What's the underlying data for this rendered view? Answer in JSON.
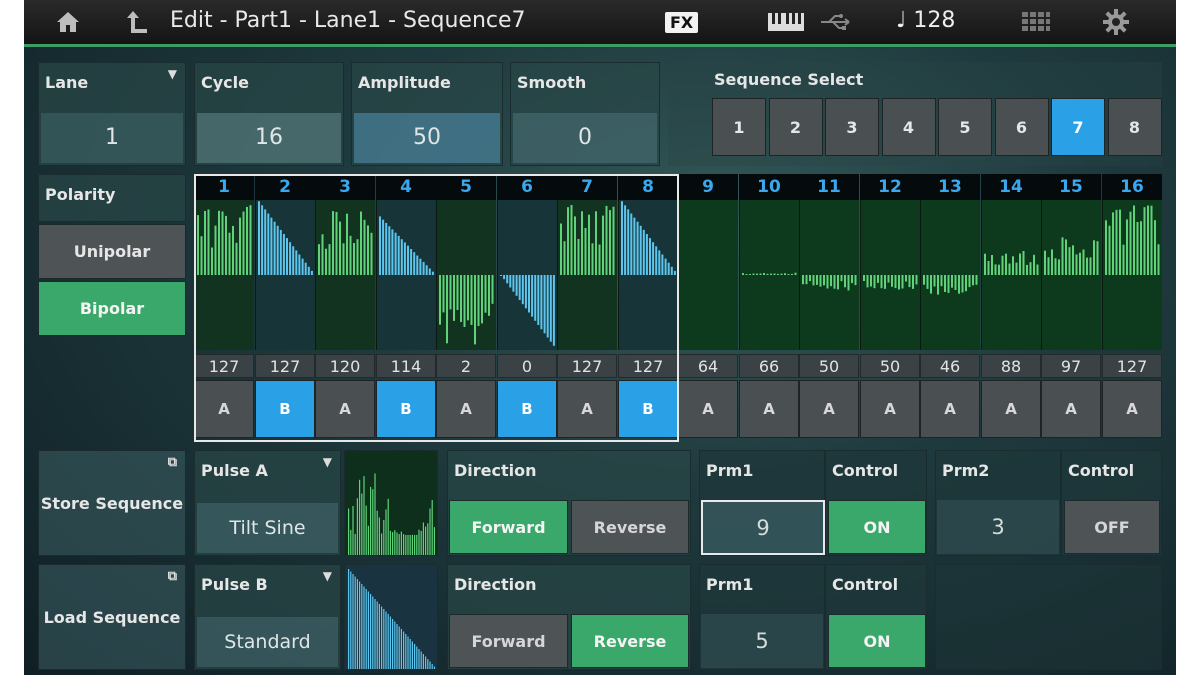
{
  "header": {
    "title": "Edit - Part1 - Lane1 - Sequence7",
    "fx_label": "FX",
    "tempo": "128",
    "icons": [
      "home-icon",
      "back-icon",
      "fx-badge",
      "keyboard-icon",
      "usb-icon",
      "note-icon",
      "grid-icon",
      "gear-icon"
    ]
  },
  "lane": {
    "label": "Lane",
    "value": "1"
  },
  "cycle": {
    "label": "Cycle",
    "value": "16"
  },
  "amplitude": {
    "label": "Amplitude",
    "value": "50"
  },
  "smooth": {
    "label": "Smooth",
    "value": "0"
  },
  "sequence_select": {
    "label": "Sequence Select",
    "options": [
      "1",
      "2",
      "3",
      "4",
      "5",
      "6",
      "7",
      "8"
    ],
    "selected": "7"
  },
  "polarity": {
    "label": "Polarity",
    "options": [
      "Unipolar",
      "Bipolar"
    ],
    "selected": "Bipolar"
  },
  "steps": [
    {
      "num": "1",
      "value": "127",
      "pulse": "A"
    },
    {
      "num": "2",
      "value": "127",
      "pulse": "B"
    },
    {
      "num": "3",
      "value": "120",
      "pulse": "A"
    },
    {
      "num": "4",
      "value": "114",
      "pulse": "B"
    },
    {
      "num": "5",
      "value": "2",
      "pulse": "A"
    },
    {
      "num": "6",
      "value": "0",
      "pulse": "B"
    },
    {
      "num": "7",
      "value": "127",
      "pulse": "A"
    },
    {
      "num": "8",
      "value": "127",
      "pulse": "B"
    },
    {
      "num": "9",
      "value": "64",
      "pulse": "A"
    },
    {
      "num": "10",
      "value": "66",
      "pulse": "A"
    },
    {
      "num": "11",
      "value": "50",
      "pulse": "A"
    },
    {
      "num": "12",
      "value": "50",
      "pulse": "A"
    },
    {
      "num": "13",
      "value": "46",
      "pulse": "A"
    },
    {
      "num": "14",
      "value": "88",
      "pulse": "A"
    },
    {
      "num": "15",
      "value": "97",
      "pulse": "A"
    },
    {
      "num": "16",
      "value": "127",
      "pulse": "A"
    }
  ],
  "store_sequence": {
    "label": "Store Sequence"
  },
  "load_sequence": {
    "label": "Load Sequence"
  },
  "pulse_a": {
    "label": "Pulse A",
    "value": "Tilt Sine",
    "direction_label": "Direction",
    "directions": [
      "Forward",
      "Reverse"
    ],
    "direction_selected": "Forward",
    "prm1_label": "Prm1",
    "prm1_value": "9",
    "control1_label": "Control",
    "control1_value": "ON",
    "prm2_label": "Prm2",
    "prm2_value": "3",
    "control2_label": "Control",
    "control2_value": "OFF"
  },
  "pulse_b": {
    "label": "Pulse B",
    "value": "Standard",
    "direction_label": "Direction",
    "directions": [
      "Forward",
      "Reverse"
    ],
    "direction_selected": "Reverse",
    "prm1_label": "Prm1",
    "prm1_value": "5",
    "control1_label": "Control",
    "control1_value": "ON"
  },
  "colors": {
    "accent_green": "#3aa86a",
    "accent_blue": "#2aa0e6",
    "topbar_line": "#3c9c66"
  }
}
